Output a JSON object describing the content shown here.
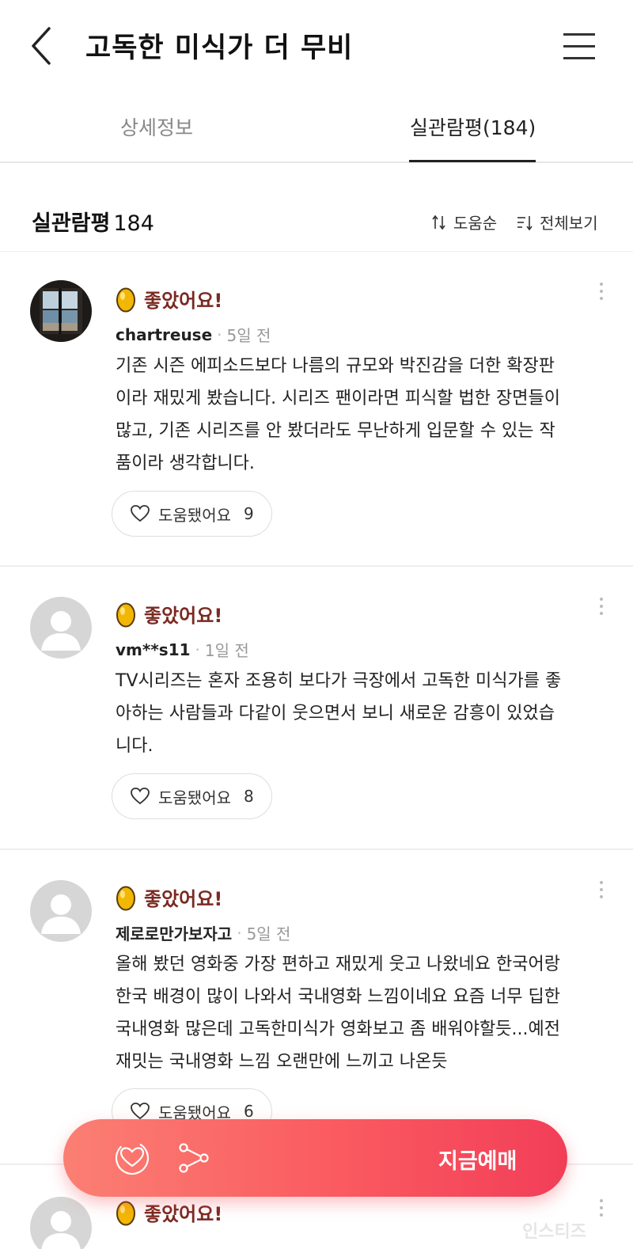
{
  "header": {
    "title": "고독한 미식가 더 무비"
  },
  "tabs": [
    {
      "label": "상세정보"
    },
    {
      "label": "실관람평(184)"
    }
  ],
  "summary": {
    "title": "실관람평",
    "count": "184",
    "sort_label": "도움순",
    "view_all_label": "전체보기"
  },
  "reviews": [
    {
      "rating_label": "좋았어요!",
      "username": "chartreuse",
      "time": "5일 전",
      "lines": [
        "기존 시즌 에피소드보다 나름의 규모와 박진감을 더한 확장판",
        "이라 재밌게 봤습니다. 시리즈 팬이라면 피식할 법한 장면들이",
        "많고, 기존 시리즈를 안 봤더라도 무난하게 입문할 수 있는 작",
        "품이라 생각합니다."
      ],
      "helpful_label": "도움됐어요",
      "helpful_count": "9"
    },
    {
      "rating_label": "좋았어요!",
      "username": "vm**s11",
      "time": "1일 전",
      "lines": [
        "TV시리즈는 혼자 조용히 보다가 극장에서 고독한 미식가를 좋",
        "아하는 사람들과 다같이 웃으면서 보니 새로운 감흥이 있었습",
        "니다."
      ],
      "helpful_label": "도움됐어요",
      "helpful_count": "8"
    },
    {
      "rating_label": "좋았어요!",
      "username": "제로로만가보자고",
      "time": "5일 전",
      "lines": [
        "올해 봤던 영화중 가장 편하고 재밌게 웃고 나왔네요 한국어랑",
        "한국 배경이 많이 나와서 국내영화 느낌이네요 요즘 너무 딥한",
        "국내영화 많은데 고독한미식가 영화보고 좀 배워야할듯...예전",
        "재밋는 국내영화 느낌 오랜만에 느끼고 나온듯"
      ],
      "helpful_label": "도움됐어요",
      "helpful_count": "6"
    },
    {
      "rating_label": "좋았어요!"
    }
  ],
  "booking_bar": {
    "book_label": "지금예매"
  },
  "watermark": "인스티즈",
  "colors": {
    "accent_start": "#fb7f73",
    "accent_end": "#f23e58",
    "rating_text": "#7a2a22",
    "egg_gold": "#f2b705"
  },
  "icons": [
    "back-arrow-icon",
    "hamburger-menu-icon",
    "sort-icon",
    "filter-list-icon",
    "golden-egg-icon",
    "heart-icon",
    "more-vertical-icon",
    "like-heart-icon",
    "share-icon"
  ]
}
